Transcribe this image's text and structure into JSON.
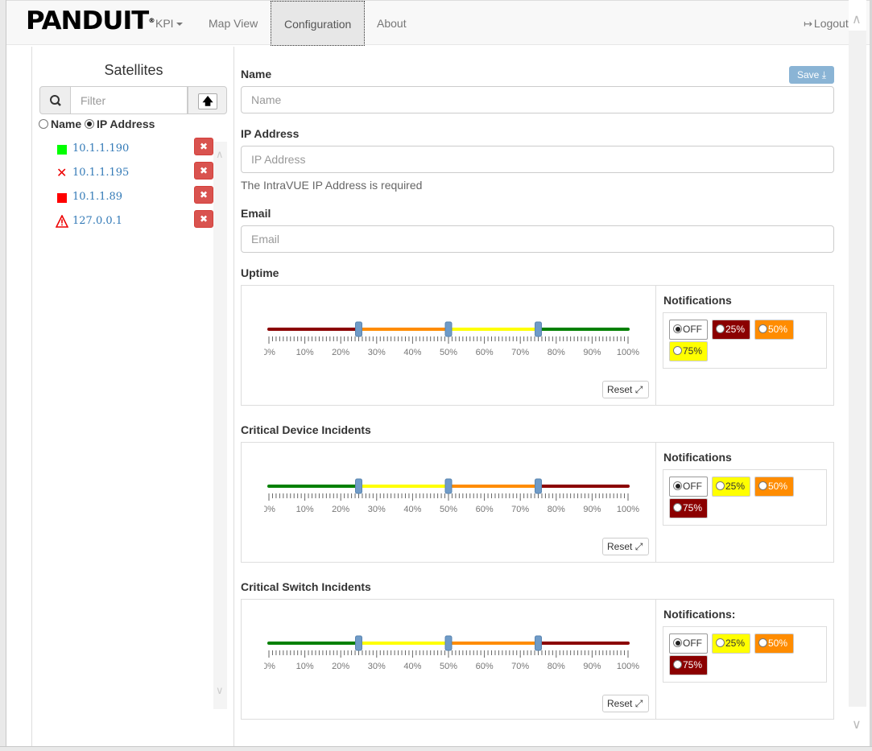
{
  "navbar": {
    "brand": "PANDUIT",
    "brand_mark": "®",
    "items": [
      {
        "label": "KPI",
        "dropdown": true
      },
      {
        "label": "Map View"
      },
      {
        "label": "Configuration",
        "active": true
      },
      {
        "label": "About"
      }
    ],
    "logout_label": "Logout"
  },
  "sidebar": {
    "title": "Satellites",
    "filter_placeholder": "Filter",
    "sort_by": {
      "name_label": "Name",
      "ip_label": "IP Address",
      "selected": "IP Address"
    },
    "satellites": [
      {
        "ip": "10.1.1.190",
        "status": "green-square"
      },
      {
        "ip": "10.1.1.195",
        "status": "red-x"
      },
      {
        "ip": "10.1.1.89",
        "status": "red-square"
      },
      {
        "ip": "127.0.0.1",
        "status": "warning-triangle"
      }
    ]
  },
  "form": {
    "save_label": "Save",
    "name": {
      "label": "Name",
      "placeholder": "Name",
      "value": ""
    },
    "ip": {
      "label": "IP Address",
      "placeholder": "IP Address",
      "value": "",
      "help": "The IntraVUE IP Address is required"
    },
    "email": {
      "label": "Email",
      "placeholder": "Email",
      "value": ""
    }
  },
  "thresholds": [
    {
      "label": "Uptime",
      "notifications_label": "Notifications",
      "segment_colors": [
        "#8b0000",
        "#ff8c00",
        "#ffff00",
        "#008000"
      ],
      "handles": [
        25,
        50,
        75
      ],
      "ticks": [
        "0%",
        "10%",
        "20%",
        "30%",
        "40%",
        "50%",
        "60%",
        "70%",
        "80%",
        "90%",
        "100%"
      ],
      "reset_label": "Reset",
      "options": [
        {
          "label": "OFF",
          "selected": true,
          "bg": "#ffffff",
          "fg": "#333333"
        },
        {
          "label": "25%",
          "selected": false,
          "bg": "#8b0000",
          "fg": "#ffffff"
        },
        {
          "label": "50%",
          "selected": false,
          "bg": "#ff8c00",
          "fg": "#ffffff"
        },
        {
          "label": "75%",
          "selected": false,
          "bg": "#ffff00",
          "fg": "#333333"
        }
      ]
    },
    {
      "label": "Critical Device Incidents",
      "notifications_label": "Notifications",
      "segment_colors": [
        "#008000",
        "#ffff00",
        "#ff8c00",
        "#8b0000"
      ],
      "handles": [
        25,
        50,
        75
      ],
      "ticks": [
        "0%",
        "10%",
        "20%",
        "30%",
        "40%",
        "50%",
        "60%",
        "70%",
        "80%",
        "90%",
        "100%"
      ],
      "reset_label": "Reset",
      "options": [
        {
          "label": "OFF",
          "selected": true,
          "bg": "#ffffff",
          "fg": "#333333"
        },
        {
          "label": "25%",
          "selected": false,
          "bg": "#ffff00",
          "fg": "#333333"
        },
        {
          "label": "50%",
          "selected": false,
          "bg": "#ff8c00",
          "fg": "#ffffff"
        },
        {
          "label": "75%",
          "selected": false,
          "bg": "#8b0000",
          "fg": "#ffffff"
        }
      ]
    },
    {
      "label": "Critical Switch Incidents",
      "notifications_label": "Notifications:",
      "segment_colors": [
        "#008000",
        "#ffff00",
        "#ff8c00",
        "#8b0000"
      ],
      "handles": [
        25,
        50,
        75
      ],
      "ticks": [
        "0%",
        "10%",
        "20%",
        "30%",
        "40%",
        "50%",
        "60%",
        "70%",
        "80%",
        "90%",
        "100%"
      ],
      "reset_label": "Reset",
      "options": [
        {
          "label": "OFF",
          "selected": true,
          "bg": "#ffffff",
          "fg": "#333333"
        },
        {
          "label": "25%",
          "selected": false,
          "bg": "#ffff00",
          "fg": "#333333"
        },
        {
          "label": "50%",
          "selected": false,
          "bg": "#ff8c00",
          "fg": "#ffffff"
        },
        {
          "label": "75%",
          "selected": false,
          "bg": "#8b0000",
          "fg": "#ffffff"
        }
      ]
    }
  ]
}
